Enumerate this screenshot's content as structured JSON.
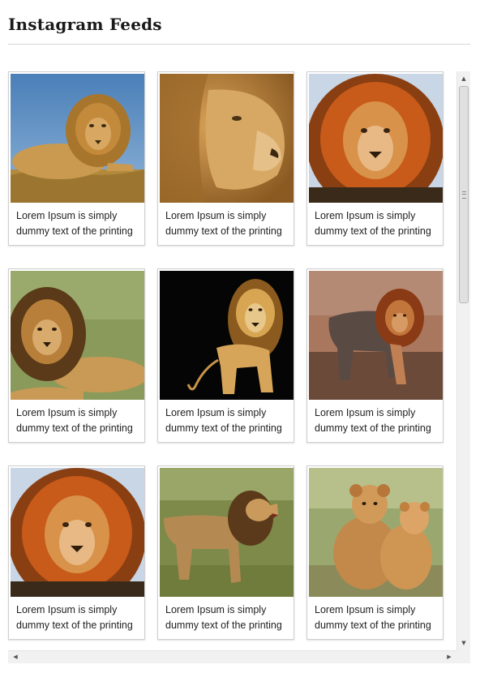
{
  "page": {
    "title": "Instagram Feeds"
  },
  "feed": {
    "items": [
      {
        "caption_line1": "Lorem Ipsum is simply",
        "caption_line2": "dummy text of the printing",
        "image": "lion-lying-blue-sky"
      },
      {
        "caption_line1": "Lorem Ipsum is simply",
        "caption_line2": "dummy text of the printing",
        "image": "lion-profile-closeup"
      },
      {
        "caption_line1": "Lorem Ipsum is simply",
        "caption_line2": "dummy text of the printing",
        "image": "lion-face-orange-mane"
      },
      {
        "caption_line1": "Lorem Ipsum is simply",
        "caption_line2": "dummy text of the printing",
        "image": "lion-lying-grass"
      },
      {
        "caption_line1": "Lorem Ipsum is simply",
        "caption_line2": "dummy text of the printing",
        "image": "lion-walking-black-background"
      },
      {
        "caption_line1": "Lorem Ipsum is simply",
        "caption_line2": "dummy text of the printing",
        "image": "lion-walking-dirt"
      },
      {
        "caption_line1": "Lorem Ipsum is simply",
        "caption_line2": "dummy text of the printing",
        "image": "lion-face-orange-mane"
      },
      {
        "caption_line1": "Lorem Ipsum is simply",
        "caption_line2": "dummy text of the printing",
        "image": "lion-roaring-field"
      },
      {
        "caption_line1": "Lorem Ipsum is simply",
        "caption_line2": "dummy text of the printing",
        "image": "lion-cubs-sitting"
      }
    ]
  },
  "colors": {
    "card_border": "#cfcfcf",
    "rule": "#d6d6d6",
    "scrollbar_track": "#f1f1f1"
  }
}
